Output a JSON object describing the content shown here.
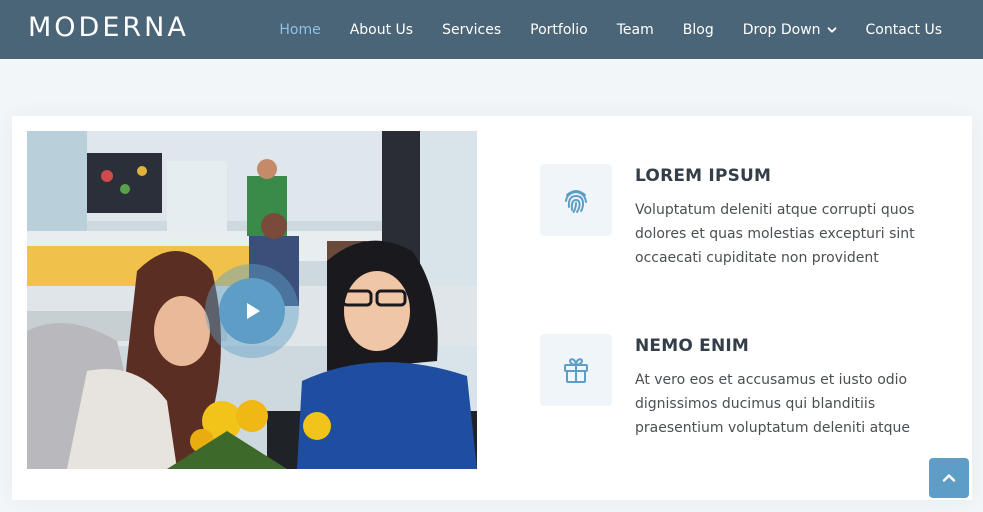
{
  "header": {
    "logo": "MODERNA",
    "nav": [
      {
        "label": "Home",
        "active": true
      },
      {
        "label": "About Us"
      },
      {
        "label": "Services"
      },
      {
        "label": "Portfolio"
      },
      {
        "label": "Team"
      },
      {
        "label": "Blog"
      },
      {
        "label": "Drop Down",
        "has_dropdown": true
      },
      {
        "label": "Contact Us"
      }
    ]
  },
  "colors": {
    "header_bg": "#4a6577",
    "accent": "#5e9ec6",
    "active_nav": "#8fc1e6",
    "page_bg": "#f2f6f9",
    "icon_box_bg": "#eff5f9"
  },
  "features": [
    {
      "icon": "fingerprint-icon",
      "title": "LOREM IPSUM",
      "description": "Voluptatum deleniti atque corrupti quos dolores et quas molestias excepturi sint occaecati cupiditate non provident"
    },
    {
      "icon": "gift-icon",
      "title": "NEMO ENIM",
      "description": "At vero eos et accusamus et iusto odio dignissimos ducimus qui blanditiis praesentium voluptatum deleniti atque"
    }
  ],
  "media": {
    "photo": "office-photo",
    "play_icon": "play-icon"
  },
  "back_to_top": {
    "icon": "chevron-up-icon"
  }
}
